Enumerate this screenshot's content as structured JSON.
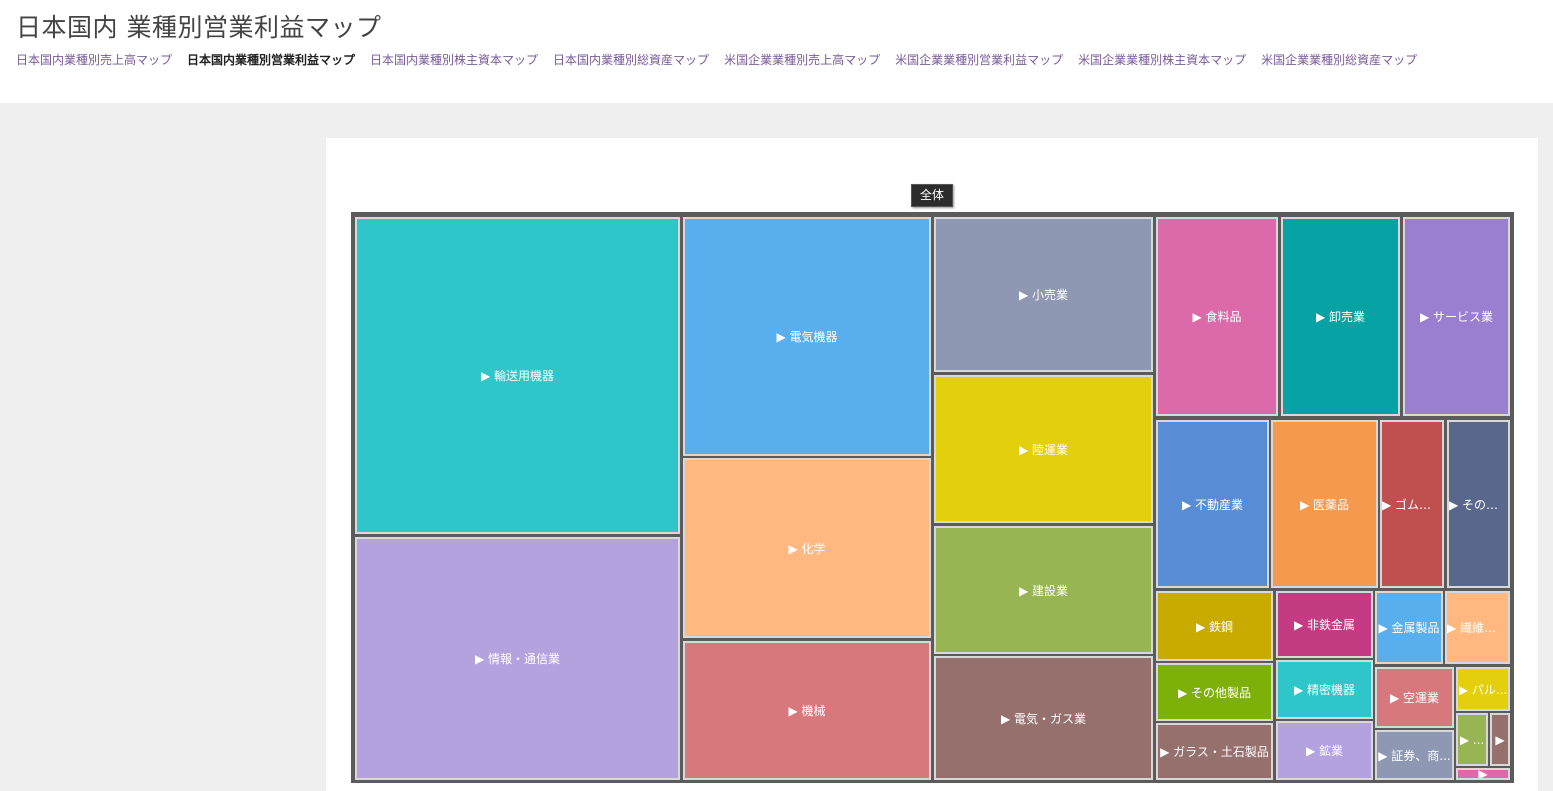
{
  "header": {
    "title": "日本国内 業種別営業利益マップ",
    "nav": [
      {
        "label": "日本国内業種別売上高マップ",
        "active": false
      },
      {
        "label": "日本国内業種別営業利益マップ",
        "active": true
      },
      {
        "label": "日本国内業種別株主資本マップ",
        "active": false
      },
      {
        "label": "日本国内業種別総資産マップ",
        "active": false
      },
      {
        "label": "米国企業業種別売上高マップ",
        "active": false
      },
      {
        "label": "米国企業業種別営業利益マップ",
        "active": false
      },
      {
        "label": "米国企業業種別株主資本マップ",
        "active": false
      },
      {
        "label": "米国企業業種別総資産マップ",
        "active": false
      }
    ]
  },
  "chart_data": {
    "type": "treemap",
    "root_label": "全体",
    "marker": "▶",
    "tiles": [
      {
        "name": "輸送用機器",
        "color": "#2ec6c9"
      },
      {
        "name": "情報・通信業",
        "color": "#b4a2de"
      },
      {
        "name": "電気機器",
        "color": "#59aeee"
      },
      {
        "name": "化学",
        "color": "#ffb87f"
      },
      {
        "name": "機械",
        "color": "#d7797c"
      },
      {
        "name": "小売業",
        "color": "#8e98b2"
      },
      {
        "name": "陸運業",
        "color": "#e4cf0d"
      },
      {
        "name": "建設業",
        "color": "#97b552"
      },
      {
        "name": "電気・ガス業",
        "color": "#95706d"
      },
      {
        "name": "食料品",
        "color": "#dc69aa"
      },
      {
        "name": "卸売業",
        "color": "#07a2a4"
      },
      {
        "name": "サービス業",
        "color": "#9a7fd1"
      },
      {
        "name": "不動産業",
        "color": "#588dd5"
      },
      {
        "name": "医薬品",
        "color": "#f5994e"
      },
      {
        "name": "ゴム製品",
        "color": "#c05050"
      },
      {
        "name": "その他...",
        "color": "#59678c"
      },
      {
        "name": "鉄鋼",
        "color": "#c9ab00"
      },
      {
        "name": "非鉄金属",
        "color": "#c23b83"
      },
      {
        "name": "金属製品",
        "color": "#59aeee"
      },
      {
        "name": "繊維製品",
        "color": "#ffb87f"
      },
      {
        "name": "その他製品",
        "color": "#7eb00a"
      },
      {
        "name": "精密機器",
        "color": "#2ec6c9"
      },
      {
        "name": "空運業",
        "color": "#d7797c"
      },
      {
        "name": "パル...",
        "color": "#e4cf0d"
      },
      {
        "name": "ガラス・土石製品",
        "color": "#95706d"
      },
      {
        "name": "鉱業",
        "color": "#b4a2de"
      },
      {
        "name": "証券、商...",
        "color": "#8e98b2"
      },
      {
        "name": "...",
        "color": "#97b552"
      },
      {
        "name": "",
        "color": "#95706d"
      },
      {
        "name": "",
        "color": "#dc69aa"
      }
    ]
  }
}
